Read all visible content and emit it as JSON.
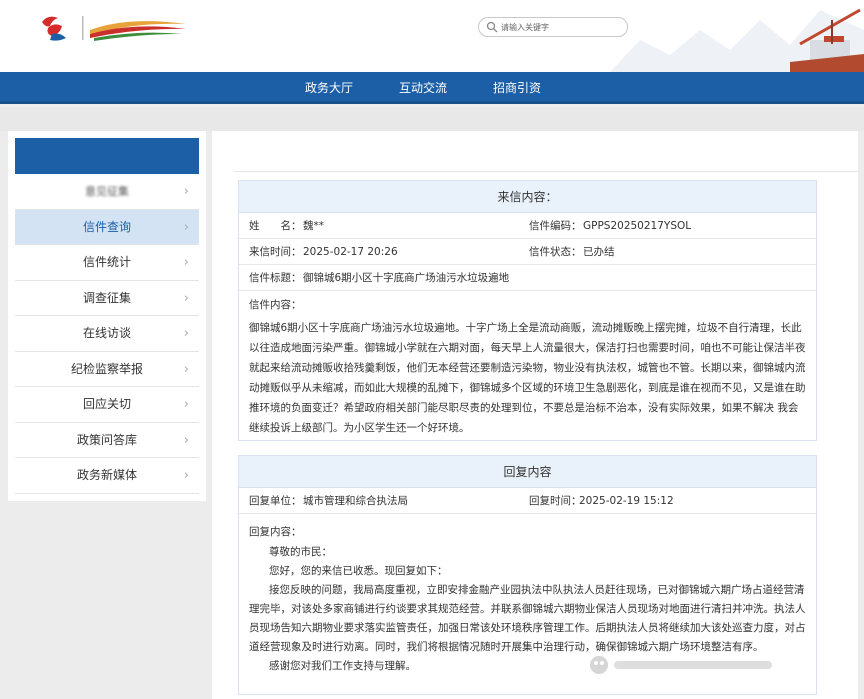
{
  "header": {
    "search_placeholder": "请输入关键字"
  },
  "nav": {
    "items": [
      "政务大厅",
      "互动交流",
      "招商引资"
    ]
  },
  "sidebar": {
    "items": [
      {
        "label": "意见征集",
        "blurred": true
      },
      {
        "label": "信件查询",
        "active": true
      },
      {
        "label": "信件统计"
      },
      {
        "label": "调查征集"
      },
      {
        "label": "在线访谈"
      },
      {
        "label": "纪检监察举报"
      },
      {
        "label": "回应关切"
      },
      {
        "label": "政策问答库"
      },
      {
        "label": "政务新媒体"
      }
    ]
  },
  "letter": {
    "title": "来信内容：",
    "name_label": "姓　　名：",
    "name_value": "魏**",
    "code_label": "信件编码：",
    "code_value": "GPPS20250217YSOL",
    "time_label": "来信时间：",
    "time_value": "2025-02-17 20:26",
    "status_label": "信件状态：",
    "status_value": "已办结",
    "subject_label": "信件标题：",
    "subject_value": "御锦城6期小区十字底商广场油污水垃圾遍地",
    "content_label": "信件内容：",
    "content_value": "御锦城6期小区十字底商广场油污水垃圾遍地。十字广场上全是流动商贩，流动摊贩晚上摆完摊，垃圾不自行清理，长此以往造成地面污染严重。御锦城小学就在六期对面，每天早上人流量很大，保洁打扫也需要时间，咱也不可能让保洁半夜就起来给流动摊贩收拾残羹剩饭，他们无本经营还要制造污染物，物业没有执法权，城管也不管。长期以来，御锦城内流动摊贩似乎从未缩减，而如此大规模的乱摊下，御锦城多个区域的环境卫生急剧恶化，到底是谁在视而不见，又是谁在助推环境的负面变迁？希望政府相关部门能尽职尽责的处理到位，不要总是治标不治本，没有实际效果，如果不解决 我会继续投诉上级部门。为小区学生还一个好环境。"
  },
  "reply": {
    "title": "回复内容",
    "unit_label": "回复单位：",
    "unit_value": "城市管理和综合执法局",
    "time_label": "回复时间：",
    "time_value": "2025-02-19 15:12",
    "content_label": "回复内容：",
    "greeting": "尊敬的市民：",
    "line1": "您好，您的来信已收悉。现回复如下：",
    "body": "接您反映的问题，我局高度重视，立即安排金融产业园执法中队执法人员赶往现场，已对御锦城六期广场占道经营清理完毕，对该处多家商铺进行约谈要求其规范经营。并联系御锦城六期物业保洁人员现场对地面进行清扫并冲洗。执法人员现场告知六期物业要求落实监管责任，加强日常该处环境秩序管理工作。后期执法人员将继续加大该处巡查力度，对占道经营现象及时进行劝离。同时，我们将根据情况随时开展集中治理行动，确保御锦城六期广场环境整洁有序。",
    "closing": "感谢您对我们工作支持与理解。"
  }
}
